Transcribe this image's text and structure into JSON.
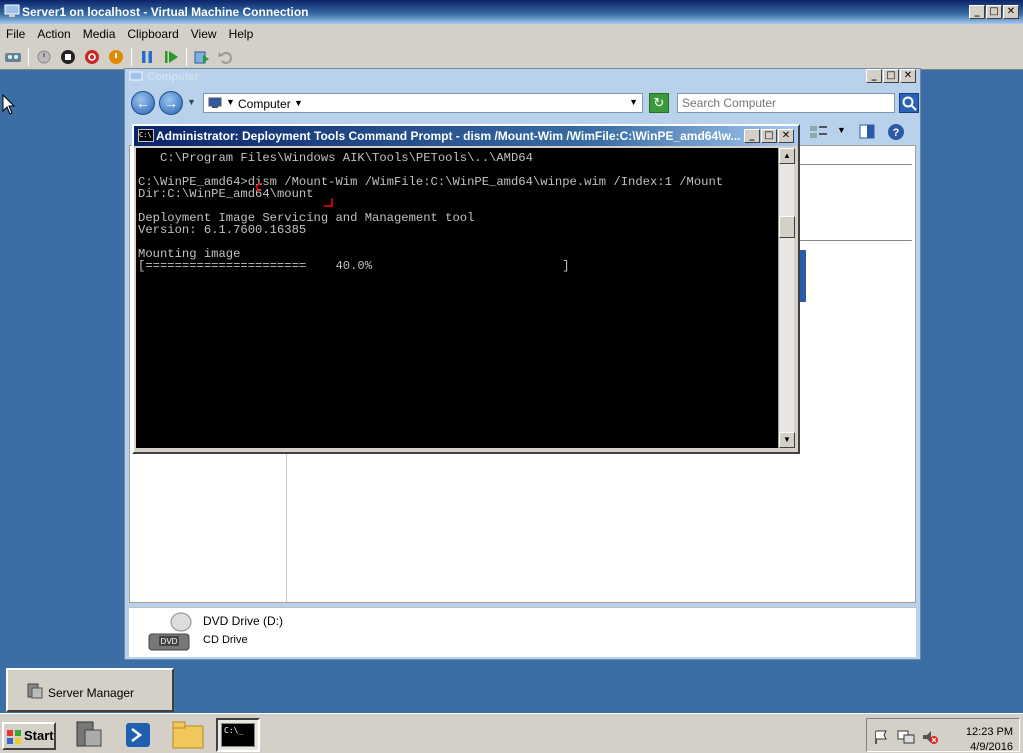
{
  "window": {
    "title": "Server1 on localhost - Virtual Machine Connection"
  },
  "menu": [
    "File",
    "Action",
    "Media",
    "Clipboard",
    "View",
    "Help"
  ],
  "toolbar_icons": [
    "ctrl-alt-del-icon",
    "start-icon",
    "turn-off-icon",
    "shut-down-icon",
    "save-icon",
    "pause-icon",
    "reset-icon",
    "snapshot-icon",
    "revert-icon"
  ],
  "explorer": {
    "title": "Computer",
    "address": "Computer",
    "search_placeholder": "Search Computer",
    "details": {
      "name": "DVD Drive (D:)",
      "type": "CD Drive",
      "icon_label": "DVD"
    }
  },
  "cmd": {
    "title": "Administrator: Deployment Tools Command Prompt - dism  /Mount-Wim /WimFile:C:\\WinPE_amd64\\w...",
    "icon_text": "C:\\",
    "lines": [
      "   C:\\Program Files\\Windows AIK\\Tools\\PETools\\..\\AMD64",
      "",
      "C:\\WinPE_amd64>dism /Mount-Wim /WimFile:C:\\WinPE_amd64\\winpe.wim /Index:1 /Mount",
      "Dir:C:\\WinPE_amd64\\mount",
      "",
      "Deployment Image Servicing and Management tool",
      "Version: 6.1.7600.16385",
      "",
      "Mounting image",
      "[======================    40.0%                          ]"
    ],
    "progress_percent": 40.0
  },
  "desktop": {
    "server_manager_label": "Server Manager"
  },
  "taskbar": {
    "start_label": "Start",
    "cmd_icon_text": "C:\\_",
    "clock_time": "12:23 PM",
    "clock_date": "4/9/2016"
  },
  "colors": {
    "title_blue": "#0a246a",
    "desktop": "#3a6ea5",
    "console_bg": "#000000",
    "console_fg": "#c0c0c0",
    "annotation_red": "#ff0000"
  }
}
